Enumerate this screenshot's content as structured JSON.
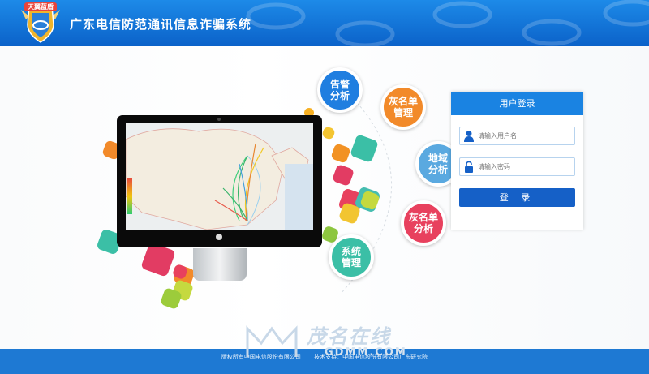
{
  "header": {
    "logo_text": "天翼蓝盾",
    "title": "广东电信防范通讯信息诈骗系统"
  },
  "features": [
    {
      "label": "告警分析",
      "line1": "告警",
      "line2": "分析",
      "color": "#1f7ee0"
    },
    {
      "label": "灰名单管理",
      "line1": "灰名单",
      "line2": "管理",
      "color": "#f28a2a"
    },
    {
      "label": "地域分析",
      "line1": "地域",
      "line2": "分析",
      "color": "#5aa9e0"
    },
    {
      "label": "灰名单分析",
      "line1": "灰名单",
      "line2": "分析",
      "color": "#e8415e"
    },
    {
      "label": "系统管理",
      "line1": "系统",
      "line2": "管理",
      "color": "#3bbfa6"
    }
  ],
  "login": {
    "title": "用户登录",
    "username_placeholder": "请输入用户名",
    "password_placeholder": "请输入密码",
    "submit_label": "登 录"
  },
  "footer": {
    "copyright": "版权所有中国电信股份有限公司",
    "support": "技术支持：中国电信股份有限公司广东研究院"
  },
  "watermark": {
    "text_cn": "茂名在线",
    "text_en": "GDMM.COM"
  }
}
